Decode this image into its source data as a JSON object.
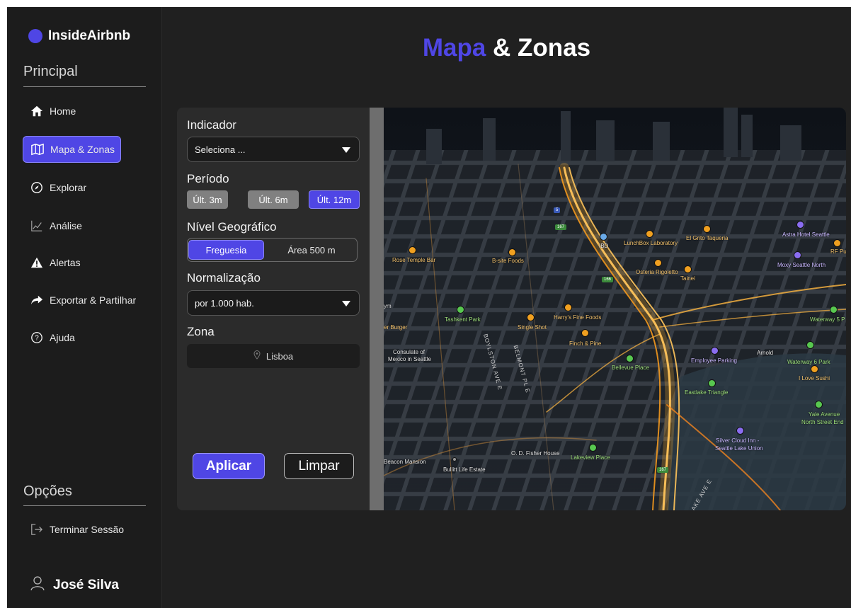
{
  "app": {
    "brand": "InsideAirbnb"
  },
  "sidebar": {
    "section_main": "Principal",
    "section_options": "Opções",
    "items": [
      {
        "label": "Home",
        "icon": "home-icon"
      },
      {
        "label": "Mapa & Zonas",
        "icon": "map-icon",
        "active": true
      },
      {
        "label": "Explorar",
        "icon": "compass-icon"
      },
      {
        "label": "Análise",
        "icon": "chart-icon"
      },
      {
        "label": "Alertas",
        "icon": "warning-icon"
      },
      {
        "label": "Exportar & Partilhar",
        "icon": "share-icon"
      },
      {
        "label": "Ajuda",
        "icon": "help-icon"
      }
    ],
    "logout": {
      "label": "Terminar Sessão",
      "icon": "logout-icon"
    },
    "user": {
      "name": "José Silva",
      "icon": "user-icon"
    }
  },
  "header": {
    "title_accent": "Mapa",
    "title_rest": " & Zonas"
  },
  "filters": {
    "indicator": {
      "label": "Indicador",
      "value": "Seleciona ..."
    },
    "period": {
      "label": "Período",
      "options": [
        "Últ. 3m",
        "Últ. 6m",
        "Últ. 12m"
      ],
      "selected": "Últ. 12m"
    },
    "geo_level": {
      "label": "Nível Geográfico",
      "options": [
        "Freguesia",
        "Área 500 m"
      ],
      "selected": "Freguesia"
    },
    "normalization": {
      "label": "Normalização",
      "value": "por 1.000 hab."
    },
    "zone": {
      "label": "Zona",
      "value": "Lisboa",
      "icon": "location-pin-icon"
    },
    "apply_label": "Aplicar",
    "clear_label": "Limpar"
  },
  "map": {
    "labels": {
      "rose_temple": "Rose Temple Bar",
      "bsite": "B-site Foods",
      "lunchbox": "LunchBox Laboratory",
      "el_grito": "El Grito Taqueria",
      "astra": "Astra Hotel Seattle",
      "rfpul": "RF Pul",
      "moxy": "Moxy Seattle North",
      "osteria": "Osteria Rigoletto",
      "tainei": "Tainei",
      "ibd": "IBD",
      "burger": "er Burger",
      "tashkent": "Tashkent Park",
      "single_shot": "Single Shot",
      "harrys": "Harry's Fine Foods",
      "finch": "Finch & Pine",
      "bellevue": "Bellevue Place",
      "employee": "Employee Parking",
      "arnold": "Arnold",
      "waterway5": "Waterway 5 P",
      "waterway6": "Waterway 6 Park",
      "eastlake": "Eastlake Triangle",
      "love_sushi": "I Love Sushi",
      "yale": "Yale Avenue",
      "north_street": "North Street End",
      "consulate1": "Consulate of",
      "consulate2": "Mexico in Seattle",
      "silver1": "Silver Cloud Inn -",
      "silver2": "Seattle Lake Union",
      "lakeview": "Lakeview Place",
      "fisher": "O. D. Fisher House",
      "beacon": "Beacon Mansion",
      "bullitt": "Bullitt Life Estate",
      "gym": "ym",
      "boylston": "BOYLSTON AVE E",
      "belmont": "BELMONT PL E",
      "lake_ave": "LAKE AVE E",
      "shield_5": "5",
      "shield_167": "167",
      "shield_166": "166",
      "shield_167b": "167"
    }
  }
}
